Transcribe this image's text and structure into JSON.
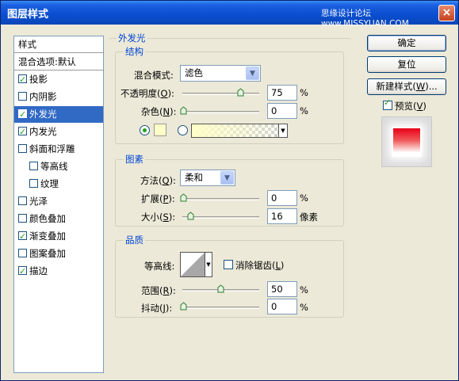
{
  "window": {
    "title": "图层样式",
    "watermark": "思缘设计论坛 www.MISSYUAN.COM",
    "close_glyph": "×"
  },
  "stylelist": {
    "items": [
      {
        "label": "样式",
        "type": "header"
      },
      {
        "label": "混合选项:默认",
        "type": "header"
      },
      {
        "label": "投影",
        "checked": true
      },
      {
        "label": "内阴影",
        "checked": false
      },
      {
        "label": "外发光",
        "checked": true,
        "selected": true
      },
      {
        "label": "内发光",
        "checked": true
      },
      {
        "label": "斜面和浮雕",
        "checked": false
      },
      {
        "label": "等高线",
        "checked": false,
        "indent": true
      },
      {
        "label": "纹理",
        "checked": false,
        "indent": true
      },
      {
        "label": "光泽",
        "checked": false
      },
      {
        "label": "颜色叠加",
        "checked": false
      },
      {
        "label": "渐变叠加",
        "checked": true
      },
      {
        "label": "图案叠加",
        "checked": false
      },
      {
        "label": "描边",
        "checked": true
      }
    ]
  },
  "outer_glow": {
    "title": "外发光",
    "structure": {
      "title": "结构",
      "blend_mode_label": "混合模式:",
      "blend_mode_value": "滤色",
      "opacity_label": "不透明度(",
      "opacity_key": "O",
      "opacity_value": "75",
      "noise_label": "杂色(",
      "noise_key": "N",
      "noise_value": "0",
      "percent": "%",
      "color_swatch": "#ffffc8"
    },
    "elements": {
      "title": "图素",
      "technique_label": "方法(",
      "technique_key": "Q",
      "technique_value": "柔和",
      "spread_label": "扩展(",
      "spread_key": "P",
      "spread_value": "0",
      "size_label": "大小(",
      "size_key": "S",
      "size_value": "16",
      "px_unit": "像素",
      "percent": "%"
    },
    "quality": {
      "title": "品质",
      "contour_label": "等高线:",
      "antialias_label": "消除锯齿(",
      "antialias_key": "L",
      "antialias_checked": false,
      "range_label": "范围(",
      "range_key": "R",
      "range_value": "50",
      "jitter_label": "抖动(",
      "jitter_key": "J",
      "jitter_value": "0",
      "percent": "%"
    }
  },
  "buttons": {
    "ok": "确定",
    "reset": "复位",
    "new_style_prefix": "新建样式(",
    "new_style_key": "W",
    "new_style_suffix": ")...",
    "preview_label": "预览(",
    "preview_key": "V",
    "preview_checked": true
  },
  "colors": {
    "accent": "#316ac5",
    "titlebar": "#0a4ed0",
    "glow": "#ffffc8",
    "preview_red": "#e8001a"
  }
}
